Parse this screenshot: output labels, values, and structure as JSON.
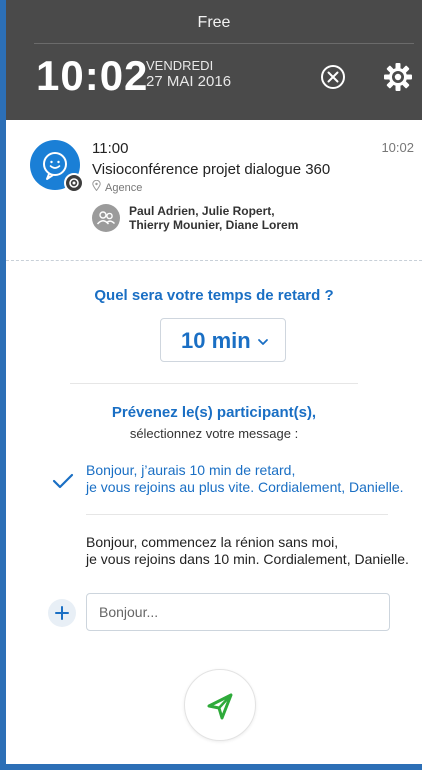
{
  "status_bar": {
    "carrier": "Free",
    "time": "10:02",
    "day_name": "VENDREDI",
    "date": "27 MAI 2016"
  },
  "notification": {
    "time": "11:00",
    "received_at": "10:02",
    "title": "Visioconférence projet dialogue 360",
    "location": "Agence",
    "participants_line1": "Paul Adrien, Julie Ropert,",
    "participants_line2": "Thierry Mounier, Diane Lorem"
  },
  "delay": {
    "question": "Quel sera votre temps de retard ?",
    "selected": "10 min"
  },
  "participants_prompt": {
    "title": "Prévenez le(s) participant(s),",
    "subtitle": "sélectionnez votre message :"
  },
  "messages": [
    {
      "line1": "Bonjour, j’aurais 10 min de retard,",
      "line2": "je vous rejoins au plus vite. Cordialement, Danielle.",
      "selected": true
    },
    {
      "line1": "Bonjour, commencez la rénion sans moi,",
      "line2": "je vous rejoins dans 10 min. Cordialement, Danielle.",
      "selected": false
    }
  ],
  "custom_message": {
    "placeholder": "Bonjour..."
  },
  "colors": {
    "accent": "#1a6fc4",
    "header_bg": "#4a4a4a",
    "send_icon": "#2eaa3a"
  },
  "icons": [
    "dismiss-icon",
    "settings-gear-icon",
    "chat-bubble-icon",
    "location-pin-icon",
    "group-icon",
    "chevron-down-icon",
    "checkmark-icon",
    "plus-icon",
    "send-icon"
  ]
}
